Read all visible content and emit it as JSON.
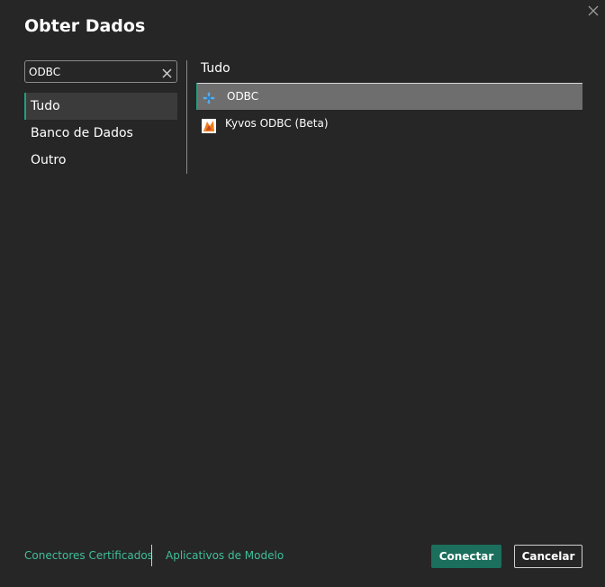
{
  "dialog": {
    "title": "Obter Dados"
  },
  "search": {
    "value": "ODBC",
    "placeholder": ""
  },
  "categories": [
    {
      "label": "Tudo",
      "selected": true
    },
    {
      "label": "Banco de Dados",
      "selected": false
    },
    {
      "label": "Outro",
      "selected": false
    }
  ],
  "results": {
    "section_title": "Tudo",
    "items": [
      {
        "label": "ODBC",
        "icon": "odbc-icon",
        "selected": true
      },
      {
        "label": "Kyvos ODBC (Beta)",
        "icon": "kyvos-icon",
        "selected": false
      }
    ]
  },
  "footer": {
    "certified_link": "Conectores Certificados",
    "template_link": "Aplicativos de Modelo",
    "connect_label": "Conectar",
    "cancel_label": "Cancelar"
  },
  "colors": {
    "background": "#262626",
    "accent": "#1f9f7f",
    "link": "#3fbf9a",
    "primary_button": "#1b6f5c",
    "selected_result": "#6e6e6e",
    "selected_category": "#3b3b3b"
  }
}
